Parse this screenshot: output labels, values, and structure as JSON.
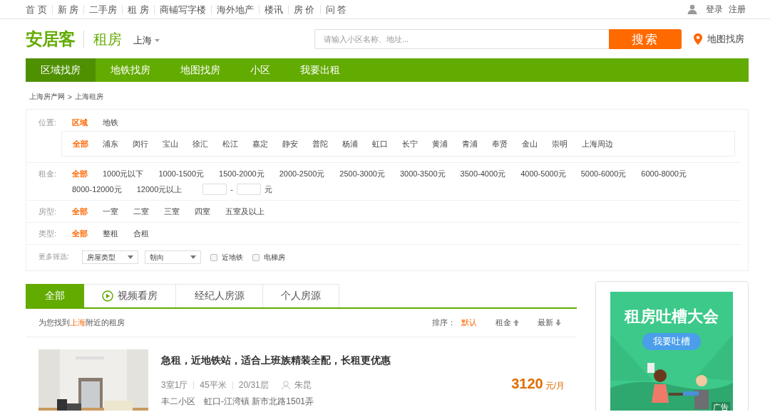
{
  "top_nav": {
    "links": [
      "首 页",
      "新 房",
      "二手房",
      "租 房",
      "商铺写字楼",
      "海外地产",
      "楼讯",
      "房 价",
      "问 答"
    ],
    "login": "登录",
    "register": "注册"
  },
  "header": {
    "logo": "安居客",
    "section": "租房",
    "city": "上海",
    "search": {
      "placeholder": "请输入小区名称、地址...",
      "button": "搜索"
    },
    "map_link": "地图找房"
  },
  "main_nav": [
    {
      "label": "区域找房",
      "selected": true
    },
    {
      "label": "地铁找房",
      "selected": false
    },
    {
      "label": "地图找房",
      "selected": false
    },
    {
      "label": "小区",
      "selected": false
    },
    {
      "label": "我要出租",
      "selected": false
    }
  ],
  "breadcrumb": {
    "items": [
      "上海房产网",
      "上海租房"
    ],
    "separator": ">"
  },
  "filters": {
    "location": {
      "label": "位置:",
      "modes": [
        {
          "label": "区域",
          "selected": true
        },
        {
          "label": "地铁",
          "selected": false
        }
      ],
      "districts": [
        {
          "label": "全部",
          "selected": true
        },
        {
          "label": "浦东",
          "selected": false
        },
        {
          "label": "闵行",
          "selected": false
        },
        {
          "label": "宝山",
          "selected": false
        },
        {
          "label": "徐汇",
          "selected": false
        },
        {
          "label": "松江",
          "selected": false
        },
        {
          "label": "嘉定",
          "selected": false
        },
        {
          "label": "静安",
          "selected": false
        },
        {
          "label": "普陀",
          "selected": false
        },
        {
          "label": "杨浦",
          "selected": false
        },
        {
          "label": "虹口",
          "selected": false
        },
        {
          "label": "长宁",
          "selected": false
        },
        {
          "label": "黄浦",
          "selected": false
        },
        {
          "label": "青浦",
          "selected": false
        },
        {
          "label": "奉贤",
          "selected": false
        },
        {
          "label": "金山",
          "selected": false
        },
        {
          "label": "崇明",
          "selected": false
        },
        {
          "label": "上海周边",
          "selected": false
        }
      ]
    },
    "rent": {
      "label": "租金:",
      "options": [
        {
          "label": "全部",
          "selected": true
        },
        {
          "label": "1000元以下",
          "selected": false
        },
        {
          "label": "1000-1500元",
          "selected": false
        },
        {
          "label": "1500-2000元",
          "selected": false
        },
        {
          "label": "2000-2500元",
          "selected": false
        },
        {
          "label": "2500-3000元",
          "selected": false
        },
        {
          "label": "3000-3500元",
          "selected": false
        },
        {
          "label": "3500-4000元",
          "selected": false
        },
        {
          "label": "4000-5000元",
          "selected": false
        },
        {
          "label": "5000-6000元",
          "selected": false
        },
        {
          "label": "6000-8000元",
          "selected": false
        },
        {
          "label": "8000-12000元",
          "selected": false
        },
        {
          "label": "12000元以上",
          "selected": false
        }
      ],
      "range_separator": "-",
      "range_unit": "元"
    },
    "rooms": {
      "label": "房型:",
      "options": [
        {
          "label": "全部",
          "selected": true
        },
        {
          "label": "一室",
          "selected": false
        },
        {
          "label": "二室",
          "selected": false
        },
        {
          "label": "三室",
          "selected": false
        },
        {
          "label": "四室",
          "selected": false
        },
        {
          "label": "五室及以上",
          "selected": false
        }
      ]
    },
    "type": {
      "label": "类型:",
      "options": [
        {
          "label": "全部",
          "selected": true
        },
        {
          "label": "整租",
          "selected": false
        },
        {
          "label": "合租",
          "selected": false
        }
      ]
    },
    "more": {
      "label": "更多筛选:",
      "selects": [
        "房屋类型",
        "朝向"
      ],
      "checkboxes": [
        {
          "label": "近地铁",
          "checked": false
        },
        {
          "label": "电梯房",
          "checked": false
        }
      ]
    }
  },
  "listing_tabs": [
    {
      "label": "全部",
      "selected": true,
      "kind": "plain"
    },
    {
      "label": "视频看房",
      "selected": false,
      "kind": "video"
    },
    {
      "label": "经纪人房源",
      "selected": false,
      "kind": "plain"
    },
    {
      "label": "个人房源",
      "selected": false,
      "kind": "plain"
    }
  ],
  "result_summary": {
    "prefix": "为您找到",
    "city": "上海",
    "suffix": "附近的租房"
  },
  "sort": {
    "label": "排序：",
    "options": [
      {
        "label": "默认",
        "selected": true,
        "kind": "plain"
      },
      {
        "label": "租金",
        "selected": false,
        "kind": "ascending"
      },
      {
        "label": "最新",
        "selected": false,
        "kind": "descending"
      }
    ]
  },
  "listings": [
    {
      "title": "急租，近地铁站，适合上班族精装全配，长租更优惠",
      "layout": "3室1厅",
      "area": "45平米",
      "floor": "20/31层",
      "agent": "朱昆",
      "community": "丰二小区",
      "district": "虹口-江湾镇",
      "address": "新市北路1501弄",
      "price": "3120",
      "price_unit": "元/月"
    }
  ],
  "ad": {
    "headline": "租房吐槽大会",
    "button": "我要吐槽",
    "label": "广告"
  }
}
